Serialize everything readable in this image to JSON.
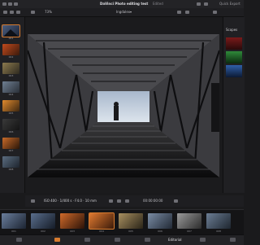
{
  "window": {
    "title": "DaVinci Photo editing test",
    "title_suffix": "Edited",
    "left_label": "Clip",
    "zoom": "73%",
    "quick_export": "Quick Export"
  },
  "viewer": {
    "colorspace": "Ingdalex"
  },
  "scopes": {
    "title": "Scopes"
  },
  "transport": {
    "timecode": "00:00:00:00",
    "meta": "ISO 400 · 1/400 s · F4.0 · 10 mm"
  },
  "bin_items": [
    {
      "label": "001"
    },
    {
      "label": "002"
    },
    {
      "label": "003"
    },
    {
      "label": "004"
    },
    {
      "label": "005"
    },
    {
      "label": "006"
    },
    {
      "label": "007"
    },
    {
      "label": "008"
    }
  ],
  "clips": [
    {
      "num": "001",
      "color": "#3a4a66"
    },
    {
      "num": "002",
      "color": "#2b3d5a"
    },
    {
      "num": "003",
      "color": "#8a3a1c"
    },
    {
      "num": "004",
      "color": "#a23a18"
    },
    {
      "num": "005",
      "color": "#6d5b3a"
    },
    {
      "num": "006",
      "color": "#4c5e74"
    },
    {
      "num": "007",
      "color": "#6b6b6b"
    },
    {
      "num": "008",
      "color": "#3d4b5c"
    }
  ],
  "bottom": {
    "page_label": "Editorial"
  }
}
